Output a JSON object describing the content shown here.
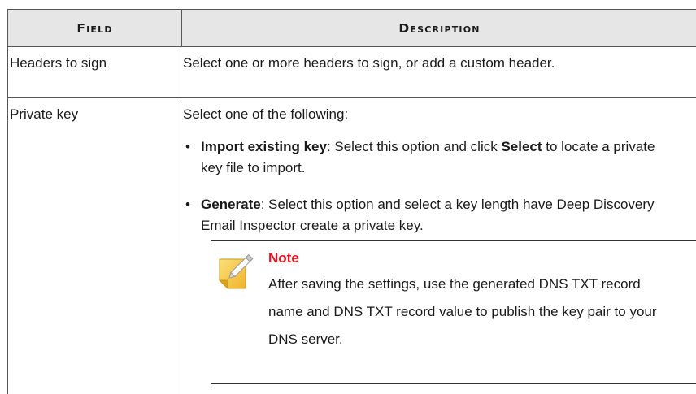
{
  "table": {
    "headers": {
      "field": "Field",
      "description": "Description"
    },
    "rows": [
      {
        "field": "Headers to sign",
        "description": "Select one or more headers to sign, or add a custom header."
      },
      {
        "field": "Private key",
        "description": "Select one of the following:",
        "bullets": [
          {
            "bold": "Import existing key",
            "text_before": ": Select this option and click ",
            "bold2": "Select",
            "text_after": " to locate a private key file to import."
          },
          {
            "bold": "Generate",
            "text": ": Select this option and select a key length have Deep Discovery Email Inspector create a private key."
          }
        ],
        "note": {
          "icon": "note-pencil-icon",
          "title": "Note",
          "body": "After saving the settings, use the generated DNS TXT record name and DNS TXT record value to publish the key pair to your DNS server."
        }
      }
    ]
  },
  "colors": {
    "header_bg": "#e6e6e6",
    "note_title": "#e8101a",
    "note_icon": "#f5c842"
  }
}
